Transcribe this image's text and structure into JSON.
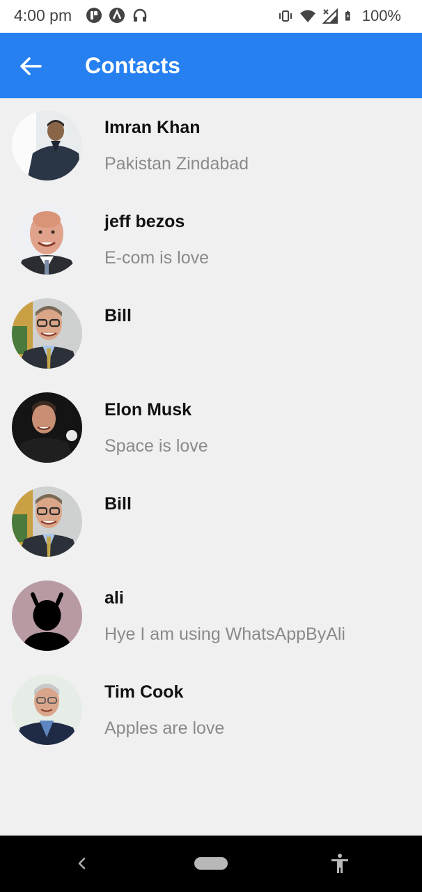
{
  "status_bar": {
    "time": "4:00 pm",
    "battery": "100%",
    "left_icons": [
      "app-notification-icon",
      "app-notification-icon",
      "headphones-icon"
    ],
    "right_icons": [
      "vibrate-icon",
      "wifi-icon",
      "no-signal-icon",
      "battery-icon"
    ]
  },
  "app_bar": {
    "title": "Contacts",
    "back_icon": "arrow-left-icon",
    "background": "#2680f0"
  },
  "contacts": [
    {
      "name": "Imran Khan",
      "status": "Pakistan Zindabad"
    },
    {
      "name": "jeff bezos",
      "status": "E-com is love"
    },
    {
      "name": "Bill",
      "status": ""
    },
    {
      "name": "Elon Musk",
      "status": "Space is love"
    },
    {
      "name": "Bill",
      "status": ""
    },
    {
      "name": "ali",
      "status": "Hye I am using WhatsAppByAli"
    },
    {
      "name": "Tim Cook",
      "status": "Apples are love"
    }
  ],
  "nav_bar": {
    "icons": [
      "back-chevron-icon",
      "home-pill-icon",
      "accessibility-icon"
    ]
  }
}
